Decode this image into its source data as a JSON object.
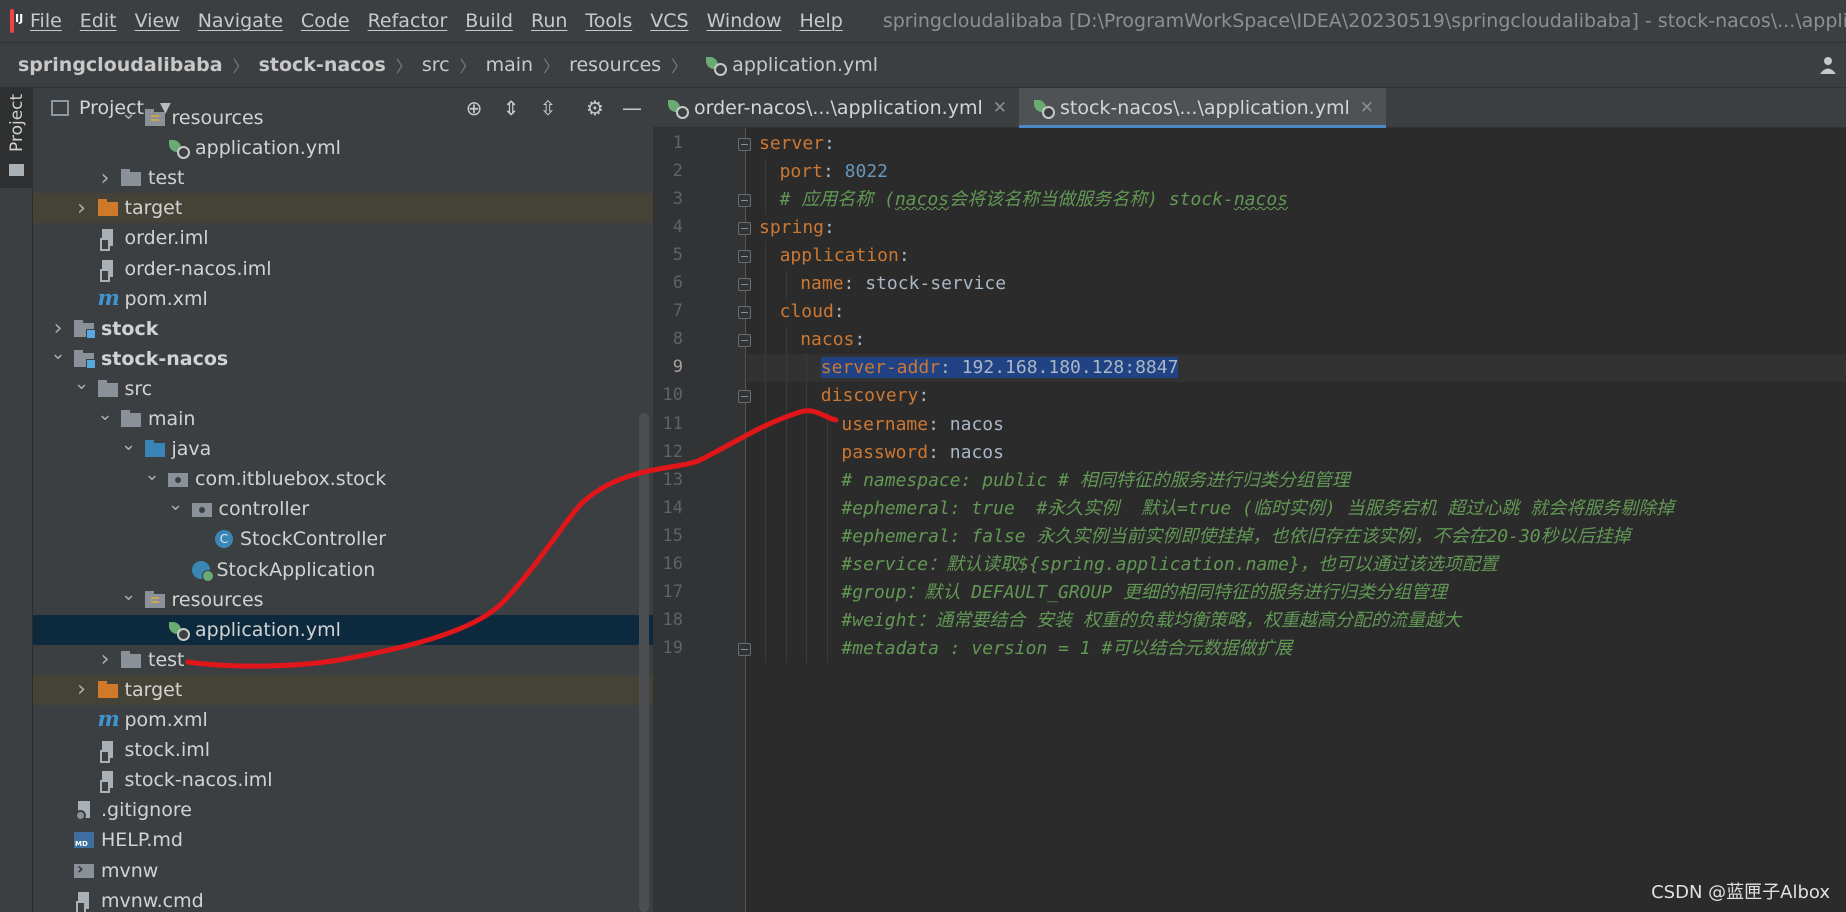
{
  "menubar": {
    "items": [
      "File",
      "Edit",
      "View",
      "Navigate",
      "Code",
      "Refactor",
      "Build",
      "Run",
      "Tools",
      "VCS",
      "Window",
      "Help"
    ],
    "window_title": "springcloudalibaba [D:\\ProgramWorkSpace\\IDEA\\20230519\\springcloudalibaba] - stock-nacos\\...\\application.yml"
  },
  "breadcrumb": [
    "springcloudalibaba",
    "stock-nacos",
    "src",
    "main",
    "resources",
    "application.yml"
  ],
  "stripe": {
    "label": "Project"
  },
  "panel": {
    "title": "Project",
    "tree": [
      {
        "label": "resources",
        "icon": "resources-folder-icon",
        "depth": 3,
        "arrow": "down"
      },
      {
        "label": "application.yml",
        "icon": "yaml-file-icon",
        "depth": 4,
        "arrow": ""
      },
      {
        "label": "test",
        "icon": "folder-icon",
        "depth": 2,
        "arrow": "right"
      },
      {
        "label": "target",
        "icon": "target-folder-icon",
        "depth": 1,
        "arrow": "right",
        "highlight": true
      },
      {
        "label": "order.iml",
        "icon": "iml-file-icon",
        "depth": 1,
        "arrow": ""
      },
      {
        "label": "order-nacos.iml",
        "icon": "iml-file-icon",
        "depth": 1,
        "arrow": ""
      },
      {
        "label": "pom.xml",
        "icon": "maven-icon",
        "depth": 1,
        "arrow": ""
      },
      {
        "label": "stock",
        "icon": "module-folder-icon",
        "depth": 0,
        "arrow": "right",
        "bold": true
      },
      {
        "label": "stock-nacos",
        "icon": "module-folder-icon",
        "depth": 0,
        "arrow": "down",
        "bold": true
      },
      {
        "label": "src",
        "icon": "folder-icon",
        "depth": 1,
        "arrow": "down"
      },
      {
        "label": "main",
        "icon": "folder-icon",
        "depth": 2,
        "arrow": "down"
      },
      {
        "label": "java",
        "icon": "source-folder-icon",
        "depth": 3,
        "arrow": "down"
      },
      {
        "label": "com.itbluebox.stock",
        "icon": "package-icon",
        "depth": 4,
        "arrow": "down"
      },
      {
        "label": "controller",
        "icon": "package-icon",
        "depth": 5,
        "arrow": "down"
      },
      {
        "label": "StockController",
        "icon": "class-icon",
        "depth": 6,
        "arrow": ""
      },
      {
        "label": "StockApplication",
        "icon": "spring-boot-class-icon",
        "depth": 5,
        "arrow": ""
      },
      {
        "label": "resources",
        "icon": "resources-folder-icon",
        "depth": 3,
        "arrow": "down"
      },
      {
        "label": "application.yml",
        "icon": "yaml-file-icon",
        "depth": 4,
        "arrow": "",
        "selected": true
      },
      {
        "label": "test",
        "icon": "folder-icon",
        "depth": 2,
        "arrow": "right"
      },
      {
        "label": "target",
        "icon": "target-folder-icon",
        "depth": 1,
        "arrow": "right",
        "highlight": true
      },
      {
        "label": "pom.xml",
        "icon": "maven-icon",
        "depth": 1,
        "arrow": ""
      },
      {
        "label": "stock.iml",
        "icon": "iml-file-icon",
        "depth": 1,
        "arrow": ""
      },
      {
        "label": "stock-nacos.iml",
        "icon": "iml-file-icon",
        "depth": 1,
        "arrow": ""
      },
      {
        "label": ".gitignore",
        "icon": "gitignore-file-icon",
        "depth": 0,
        "arrow": ""
      },
      {
        "label": "HELP.md",
        "icon": "markdown-file-icon",
        "depth": 0,
        "arrow": ""
      },
      {
        "label": "mvnw",
        "icon": "terminal-file-icon",
        "depth": 0,
        "arrow": ""
      },
      {
        "label": "mvnw.cmd",
        "icon": "file-icon",
        "depth": 0,
        "arrow": ""
      }
    ]
  },
  "tabs": [
    {
      "label": "order-nacos\\...\\application.yml",
      "active": false
    },
    {
      "label": "stock-nacos\\...\\application.yml",
      "active": true
    }
  ],
  "editor": {
    "current_line": 9,
    "lines": [
      {
        "n": "1",
        "indent": 0,
        "parts": [
          {
            "t": "server",
            "c": "k"
          },
          {
            "t": ":",
            "c": "v"
          }
        ]
      },
      {
        "n": "2",
        "indent": 1,
        "parts": [
          {
            "t": "port",
            "c": "k"
          },
          {
            "t": ": ",
            "c": "v"
          },
          {
            "t": "8022",
            "c": "n"
          }
        ]
      },
      {
        "n": "3",
        "indent": 1,
        "parts": [
          {
            "t": "# 应用名称 (",
            "c": "c"
          },
          {
            "t": "nacos",
            "c": "c c-ul"
          },
          {
            "t": "会将该名称当做服务名称) stock-",
            "c": "c"
          },
          {
            "t": "nacos",
            "c": "c c-ul"
          }
        ]
      },
      {
        "n": "4",
        "indent": 0,
        "parts": [
          {
            "t": "spring",
            "c": "k"
          },
          {
            "t": ":",
            "c": "v"
          }
        ]
      },
      {
        "n": "5",
        "indent": 1,
        "parts": [
          {
            "t": "application",
            "c": "k"
          },
          {
            "t": ":",
            "c": "v"
          }
        ]
      },
      {
        "n": "6",
        "indent": 2,
        "parts": [
          {
            "t": "name",
            "c": "k"
          },
          {
            "t": ": stock-service",
            "c": "v"
          }
        ]
      },
      {
        "n": "7",
        "indent": 1,
        "parts": [
          {
            "t": "cloud",
            "c": "k"
          },
          {
            "t": ":",
            "c": "v"
          }
        ]
      },
      {
        "n": "8",
        "indent": 2,
        "parts": [
          {
            "t": "nacos",
            "c": "k"
          },
          {
            "t": ":",
            "c": "v"
          }
        ]
      },
      {
        "n": "9",
        "indent": 3,
        "parts": [
          {
            "t": "server-addr",
            "c": "k sel"
          },
          {
            "t": ": 192.168.180.128:8847",
            "c": "v sel"
          }
        ]
      },
      {
        "n": "10",
        "indent": 3,
        "parts": [
          {
            "t": "discovery",
            "c": "k"
          },
          {
            "t": ":",
            "c": "v"
          }
        ]
      },
      {
        "n": "11",
        "indent": 4,
        "parts": [
          {
            "t": "username",
            "c": "k"
          },
          {
            "t": ": nacos",
            "c": "v"
          }
        ]
      },
      {
        "n": "12",
        "indent": 4,
        "parts": [
          {
            "t": "password",
            "c": "k"
          },
          {
            "t": ": nacos",
            "c": "v"
          }
        ]
      },
      {
        "n": "13",
        "indent": 4,
        "parts": [
          {
            "t": "# namespace: public # 相同特征的服务进行归类分组管理",
            "c": "c"
          }
        ]
      },
      {
        "n": "14",
        "indent": 4,
        "parts": [
          {
            "t": "#ephemeral: true  #永久实例  默认=true (临时实例) 当服务宕机 超过心跳 就会将服务剔除掉",
            "c": "c"
          }
        ]
      },
      {
        "n": "15",
        "indent": 4,
        "parts": [
          {
            "t": "#ephemeral: false 永久实例当前实例即使挂掉，也依旧存在该实例，不会在20-30秒以后挂掉",
            "c": "c"
          }
        ]
      },
      {
        "n": "16",
        "indent": 4,
        "parts": [
          {
            "t": "#service：默认读取${spring.application.name}，也可以通过该选项配置",
            "c": "c"
          }
        ]
      },
      {
        "n": "17",
        "indent": 4,
        "parts": [
          {
            "t": "#group：默认 DEFAULT_GROUP 更细的相同特征的服务进行归类分组管理",
            "c": "c"
          }
        ]
      },
      {
        "n": "18",
        "indent": 4,
        "parts": [
          {
            "t": "#weight：通常要结合 安装 权重的负载均衡策略，权重越高分配的流量越大",
            "c": "c"
          }
        ]
      },
      {
        "n": "19",
        "indent": 4,
        "parts": [
          {
            "t": "#metadata : version = 1 #可以结合元数据做扩展",
            "c": "c"
          }
        ]
      }
    ]
  },
  "watermark": "CSDN @蓝匣子Albox",
  "colors": {
    "annotation_stroke": "#e0161b",
    "selection": "#214283",
    "keyword": "#cc7832",
    "comment": "#629755",
    "number": "#6897bb"
  }
}
